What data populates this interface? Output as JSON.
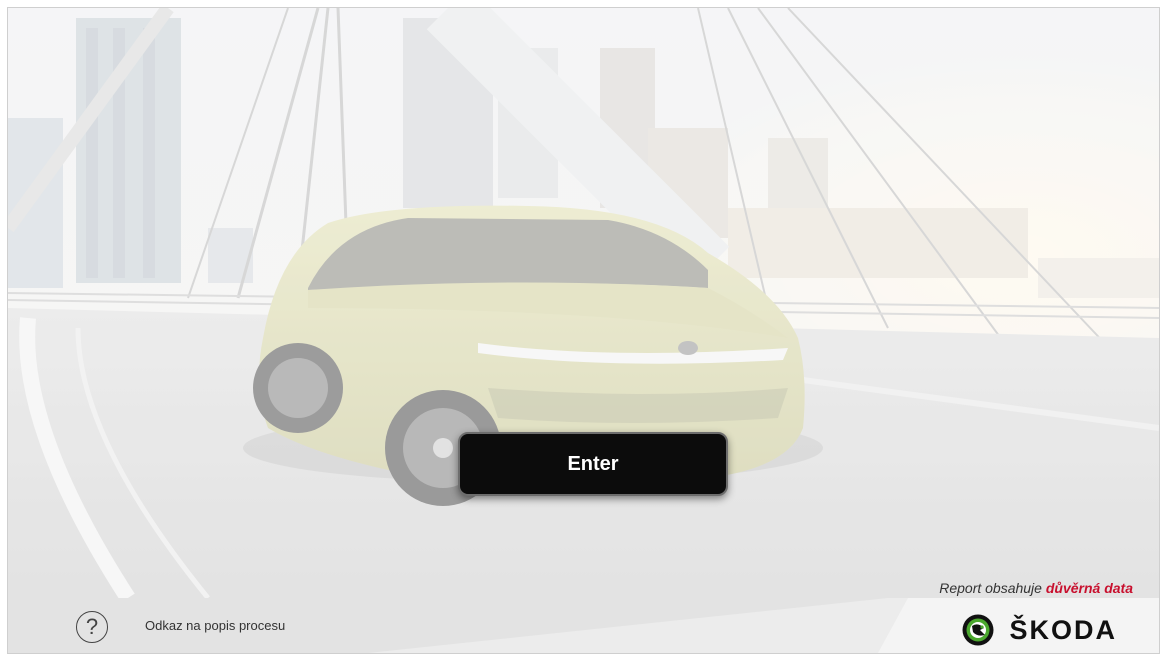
{
  "main": {
    "enter_label": "Enter"
  },
  "footer": {
    "help_icon_glyph": "?",
    "help_link_label": "Odkaz na popis procesu",
    "confidential_prefix": "Report obsahuje ",
    "confidential_highlight": "důvěrná data",
    "brand_name": "ŠKODA"
  },
  "colors": {
    "button_bg": "#0c0c0c",
    "confidential_highlight": "#c8102e",
    "brand_green": "#4ba82e",
    "car_body": "#d9d8a6"
  }
}
